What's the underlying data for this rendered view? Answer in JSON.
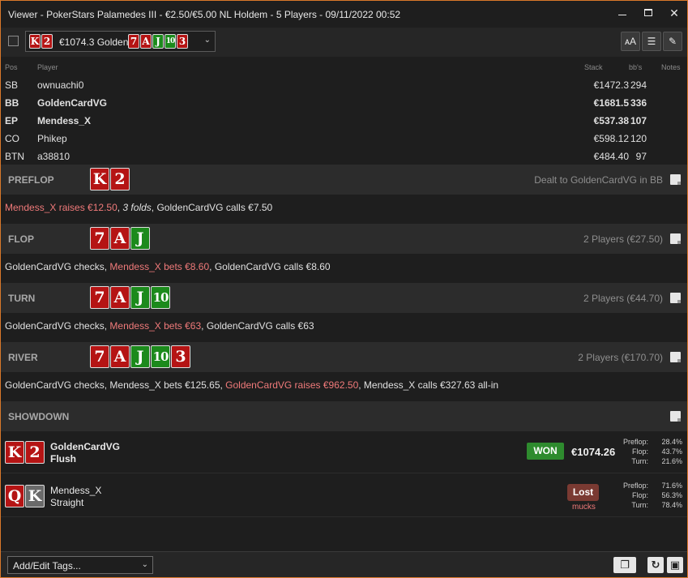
{
  "window": {
    "title": "Viewer - PokerStars Palamedes III - €2.50/€5.00 NL Holdem - 5 Players - 09/11/2022 00:52",
    "minimize_glyph": "",
    "maximize_glyph": "",
    "close_glyph": "✕"
  },
  "toolbar": {
    "hand_amount": "€1074.3 Golden",
    "hand_cards_a": [
      {
        "rank": "K",
        "color": "red"
      },
      {
        "rank": "2",
        "color": "red"
      }
    ],
    "hand_cards_b": [
      {
        "rank": "7",
        "color": "red"
      },
      {
        "rank": "A",
        "color": "red"
      },
      {
        "rank": "J",
        "color": "green"
      },
      {
        "rank": "10",
        "color": "green"
      },
      {
        "rank": "3",
        "color": "red"
      }
    ],
    "icons": [
      "font-size-icon",
      "list-icon",
      "edit-icon"
    ],
    "icon_glyphs": {
      "font": "ᴀA",
      "list": "☰",
      "edit": "✎"
    }
  },
  "players": {
    "headers": {
      "pos": "Pos",
      "player": "Player",
      "stack": "Stack",
      "bbs": "bb's",
      "notes": "Notes"
    },
    "rows": [
      {
        "pos": "SB",
        "name": "ownuachi0",
        "stack": "€1472.3",
        "bbs": "294",
        "bold": false
      },
      {
        "pos": "BB",
        "name": "GoldenCardVG",
        "stack": "€1681.5",
        "bbs": "336",
        "bold": true
      },
      {
        "pos": "EP",
        "name": "Mendess_X",
        "stack": "€537.38",
        "bbs": "107",
        "bold": true
      },
      {
        "pos": "CO",
        "name": "Phikep",
        "stack": "€598.12",
        "bbs": "120",
        "bold": false
      },
      {
        "pos": "BTN",
        "name": "a38810",
        "stack": "€484.40",
        "bbs": "97",
        "bold": false
      }
    ]
  },
  "streets": {
    "preflop": {
      "name": "PREFLOP",
      "info": "Dealt to GoldenCardVG in BB",
      "cards": [
        {
          "rank": "K",
          "color": "red"
        },
        {
          "rank": "2",
          "color": "red"
        }
      ],
      "action": [
        {
          "t": "Mendess_X raises €12.50",
          "s": "hl"
        },
        {
          "t": ", ",
          "s": ""
        },
        {
          "t": "3 folds",
          "s": "it"
        },
        {
          "t": ", GoldenCardVG calls €7.50",
          "s": ""
        }
      ]
    },
    "flop": {
      "name": "FLOP",
      "info": "2 Players (€27.50)",
      "cards": [
        {
          "rank": "7",
          "color": "red"
        },
        {
          "rank": "A",
          "color": "red"
        },
        {
          "rank": "J",
          "color": "green"
        }
      ],
      "action": [
        {
          "t": "GoldenCardVG checks, ",
          "s": ""
        },
        {
          "t": "Mendess_X bets €8.60",
          "s": "hl"
        },
        {
          "t": ", GoldenCardVG calls €8.60",
          "s": ""
        }
      ]
    },
    "turn": {
      "name": "TURN",
      "info": "2 Players (€44.70)",
      "cards": [
        {
          "rank": "7",
          "color": "red"
        },
        {
          "rank": "A",
          "color": "red"
        },
        {
          "rank": "J",
          "color": "green"
        },
        {
          "rank": "10",
          "color": "green"
        }
      ],
      "action": [
        {
          "t": "GoldenCardVG checks, ",
          "s": ""
        },
        {
          "t": "Mendess_X bets €63",
          "s": "hl"
        },
        {
          "t": ", GoldenCardVG calls €63",
          "s": ""
        }
      ]
    },
    "river": {
      "name": "RIVER",
      "info": "2 Players (€170.70)",
      "cards": [
        {
          "rank": "7",
          "color": "red"
        },
        {
          "rank": "A",
          "color": "red"
        },
        {
          "rank": "J",
          "color": "green"
        },
        {
          "rank": "10",
          "color": "green"
        },
        {
          "rank": "3",
          "color": "red"
        }
      ],
      "action": [
        {
          "t": "GoldenCardVG checks, Mendess_X bets €125.65, ",
          "s": ""
        },
        {
          "t": "GoldenCardVG raises €962.50",
          "s": "hl"
        },
        {
          "t": ", Mendess_X calls €327.63 all-in",
          "s": ""
        }
      ]
    },
    "showdown": {
      "name": "SHOWDOWN",
      "info": ""
    }
  },
  "showdown": {
    "winner": {
      "name": "GoldenCardVG",
      "hand": "Flush",
      "cards": [
        {
          "rank": "K",
          "color": "red"
        },
        {
          "rank": "2",
          "color": "red"
        }
      ],
      "badge": "WON",
      "amount": "€1074.26",
      "equity_labels": [
        "Preflop:",
        "Flop:",
        "Turn:"
      ],
      "equity_values": [
        "28.4%",
        "43.7%",
        "21.6%"
      ]
    },
    "loser": {
      "name": "Mendess_X",
      "hand": "Straight",
      "cards": [
        {
          "rank": "Q",
          "color": "red"
        },
        {
          "rank": "K",
          "color": "grey"
        }
      ],
      "badge": "Lost",
      "sub": "mucks",
      "equity_labels": [
        "Preflop:",
        "Flop:",
        "Turn:"
      ],
      "equity_values": [
        "71.6%",
        "56.3%",
        "78.4%"
      ]
    }
  },
  "bottom": {
    "tags_label": "Add/Edit Tags...",
    "icon_glyphs": {
      "copy": "❐",
      "refresh": "↻",
      "save": "▣"
    }
  },
  "colors": {
    "accent_border": "#d9782a",
    "card_red": "#b51414",
    "card_green": "#1c8a1c",
    "highlight_text": "#f07a7a",
    "won_green": "#2e8b2e",
    "lost_red": "#7a3a32"
  }
}
